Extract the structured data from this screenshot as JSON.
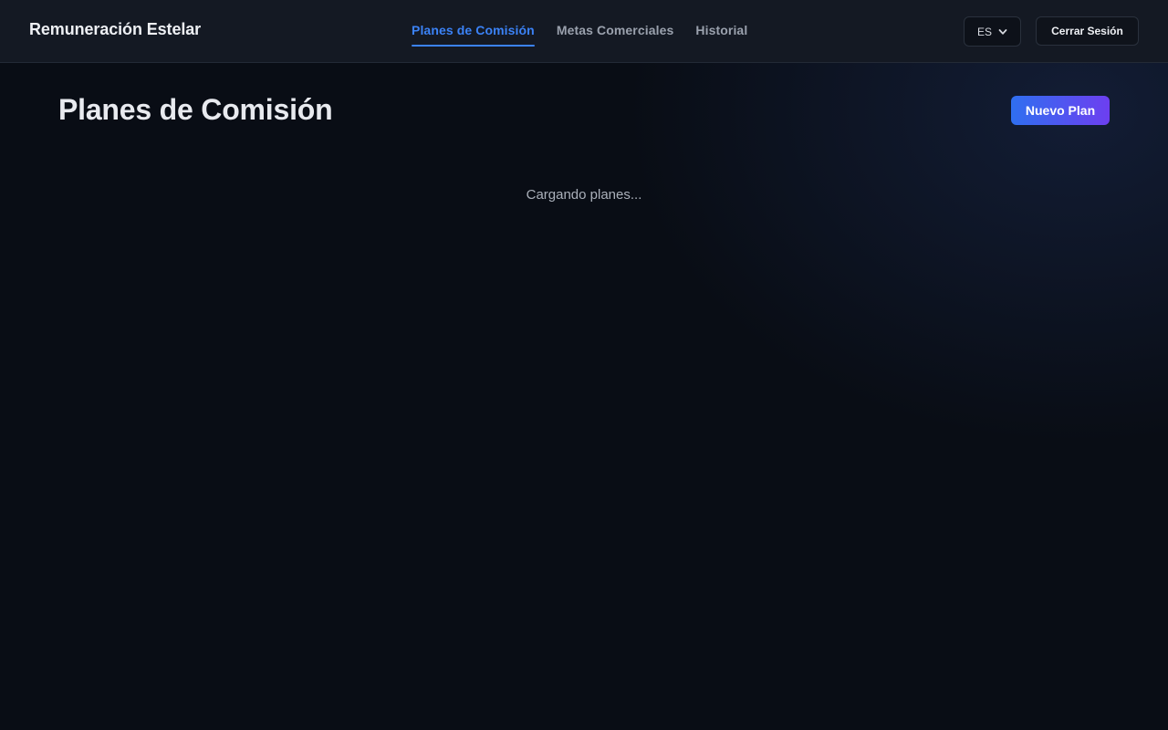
{
  "header": {
    "brand": "Remuneración Estelar",
    "nav": [
      {
        "label": "Planes de Comisión",
        "active": true
      },
      {
        "label": "Metas Comerciales",
        "active": false
      },
      {
        "label": "Historial",
        "active": false
      }
    ],
    "language": {
      "selected": "ES"
    },
    "logout_label": "Cerrar Sesión"
  },
  "main": {
    "title": "Planes de Comisión",
    "new_plan_label": "Nuevo Plan",
    "loading_text": "Cargando planes..."
  },
  "colors": {
    "accent": "#3b82f6",
    "background": "#090d15",
    "header_bg": "#141923",
    "button_gradient_start": "#2f6ff0",
    "button_gradient_end": "#6d3ff0"
  },
  "icons": {
    "language_dropdown": "chevron-down-icon"
  }
}
